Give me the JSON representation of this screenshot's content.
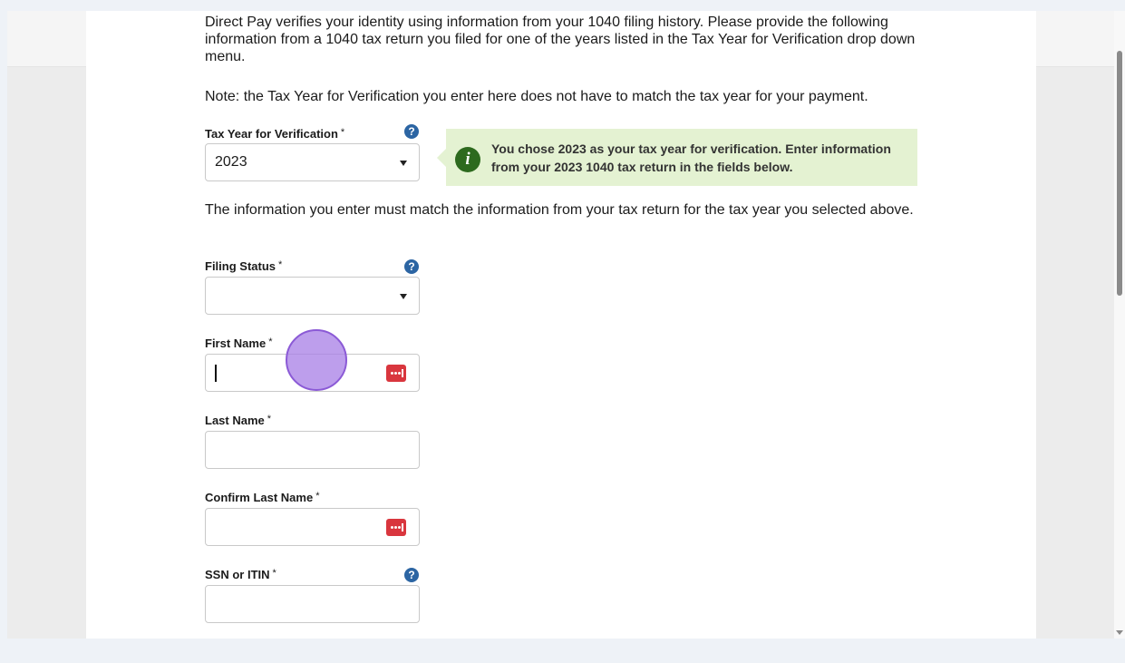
{
  "intro": {
    "paragraph1": "Direct Pay verifies your identity using information from your 1040 filing history. Please provide the following information from a 1040 tax return you filed for one of the years listed in the Tax Year for Verification drop down menu.",
    "note": "Note: the Tax Year for Verification you enter here does not have to match the tax year for your payment."
  },
  "tax_year": {
    "label": "Tax Year for Verification",
    "required_mark": "*",
    "value": "2023",
    "help_icon": "question-circle-icon"
  },
  "info_callout": {
    "icon": "info-icon",
    "icon_glyph": "i",
    "text": "You chose 2023 as your tax year for verification. Enter information from your 2023 1040 tax return in the fields below."
  },
  "match_note": "The information you enter must match the information from your tax return for the tax year you selected above.",
  "help_glyph": "?",
  "fields": {
    "filing_status": {
      "label": "Filing Status",
      "required_mark": "*",
      "value": ""
    },
    "first_name": {
      "label": "First Name",
      "required_mark": "*",
      "value": ""
    },
    "last_name": {
      "label": "Last Name",
      "required_mark": "*",
      "value": ""
    },
    "confirm_last_name": {
      "label": "Confirm Last Name",
      "required_mark": "*",
      "value": ""
    },
    "ssn_itin": {
      "label": "SSN or ITIN",
      "required_mark": "*",
      "value": ""
    }
  },
  "icons": {
    "password_manager": "password-manager-icon",
    "dropdown": "chevron-down-icon"
  },
  "colors": {
    "help_icon": "#2c65a3",
    "callout_bg": "#e4f2d2",
    "info_icon": "#2d6a1e",
    "password_icon": "#d9363e",
    "click_marker": "#a77ee6"
  }
}
